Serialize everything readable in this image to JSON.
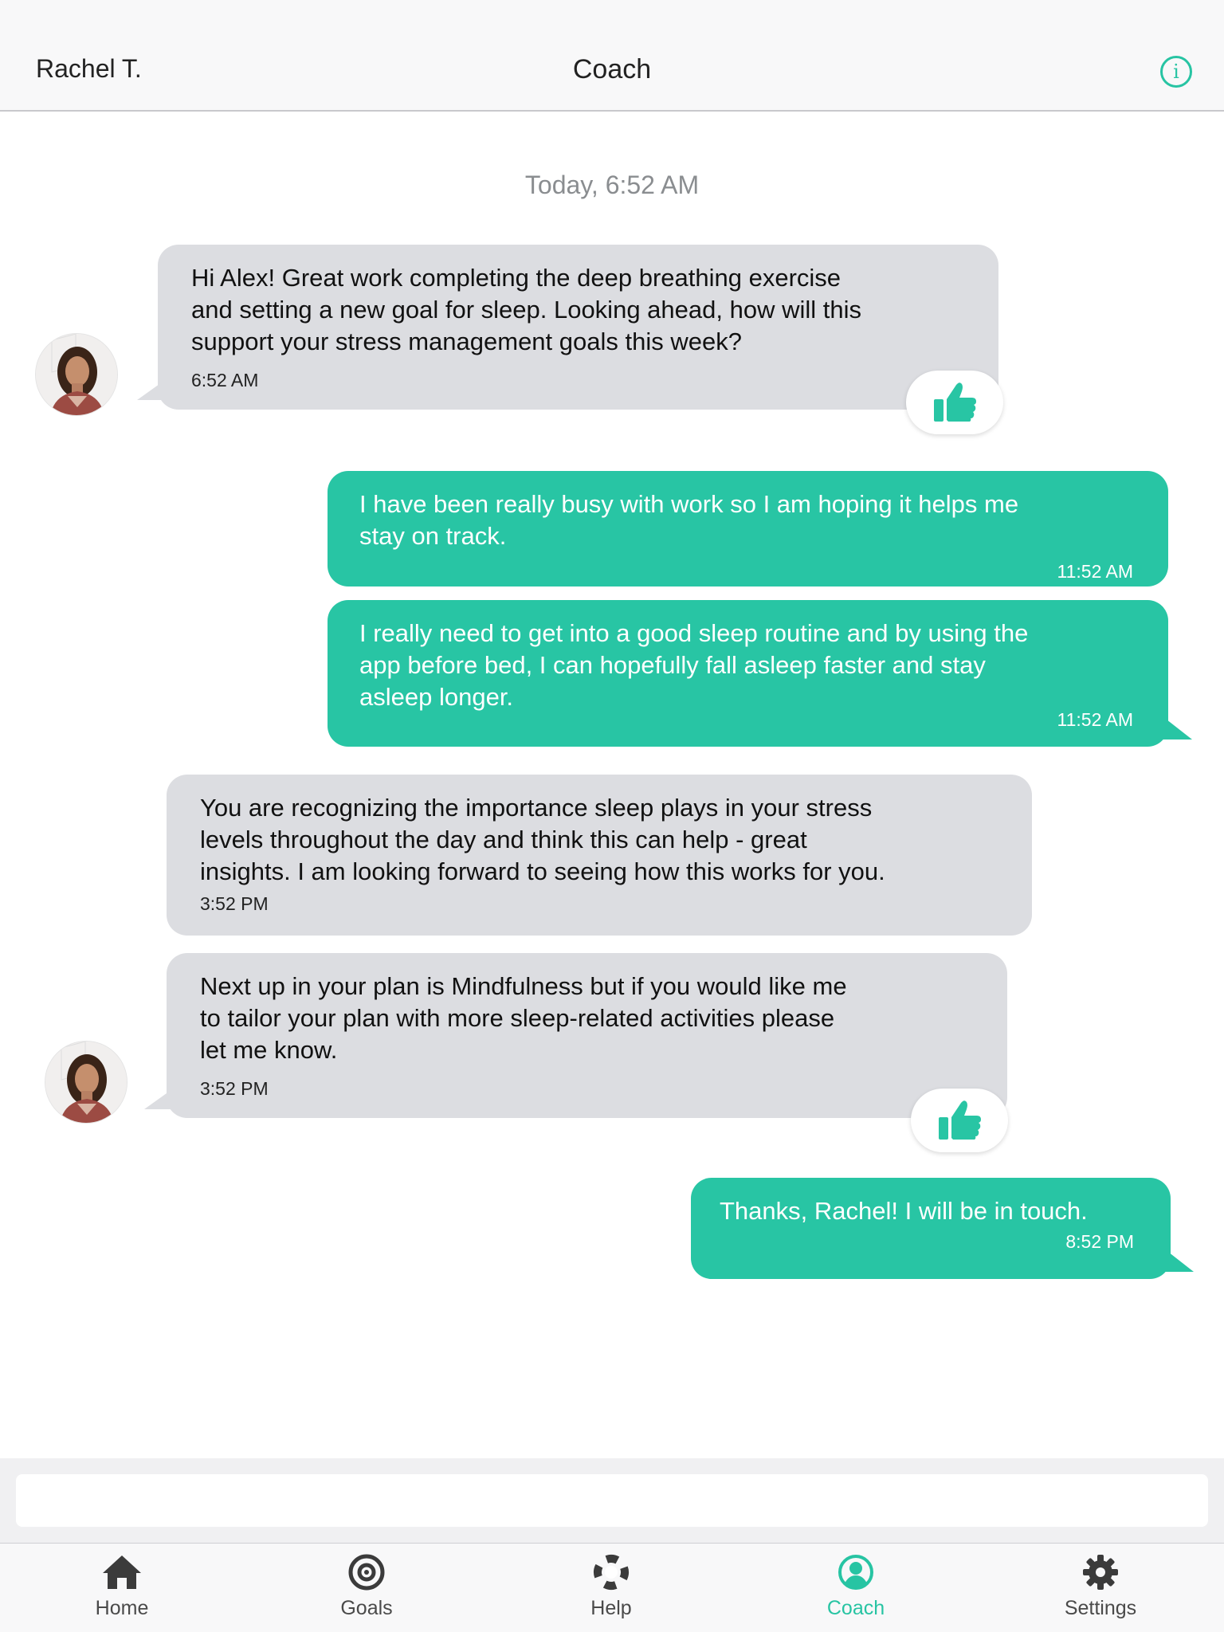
{
  "header": {
    "coach_name": "Rachel T.",
    "title": "Coach",
    "info_icon": "info-icon"
  },
  "conversation": {
    "date_separator": "Today, 6:52 AM",
    "messages": [
      {
        "sender": "coach",
        "text": "Hi Alex! Great work completing the deep breathing exercise\nand setting a new goal for sleep. Looking ahead, how will this\nsupport your stress management goals this week?",
        "time": "6:52 AM",
        "liked": true
      },
      {
        "sender": "user",
        "text": "I have been really busy with work so I am hoping it helps me\nstay on track.",
        "time": "11:52 AM"
      },
      {
        "sender": "user",
        "text": "I really need to get into a good sleep routine and by using the\napp before bed, I can hopefully fall asleep faster and stay\nasleep longer.",
        "time": "11:52 AM"
      },
      {
        "sender": "coach",
        "text": "You are recognizing the importance sleep plays in your stress\nlevels throughout the day and think this can help - great\ninsights. I am looking forward to seeing how this works for you.",
        "time": "3:52 PM"
      },
      {
        "sender": "coach",
        "text": "Next up in your plan is Mindfulness but if you would like me\nto tailor your plan with more sleep-related activities please\nlet me know.",
        "time": "3:52 PM",
        "liked": true
      },
      {
        "sender": "user",
        "text": "Thanks, Rachel! I will be in touch.",
        "time": "8:52 PM"
      }
    ]
  },
  "composer": {
    "placeholder": ""
  },
  "tabbar": {
    "items": [
      {
        "label": "Home",
        "icon": "home-icon"
      },
      {
        "label": "Goals",
        "icon": "target-icon"
      },
      {
        "label": "Help",
        "icon": "lifebuoy-icon"
      },
      {
        "label": "Coach",
        "icon": "coach-icon",
        "active": true
      },
      {
        "label": "Settings",
        "icon": "gear-icon"
      }
    ]
  },
  "colors": {
    "accent": "#28c5a4",
    "coach_bubble": "#dcdde1",
    "header_bg": "#f8f8f9",
    "muted_text": "#8a8d90"
  }
}
